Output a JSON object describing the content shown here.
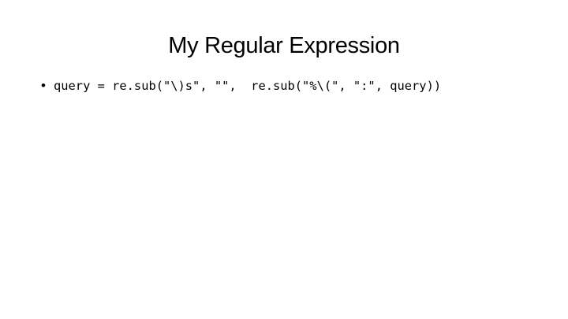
{
  "slide": {
    "title": "My Regular Expression",
    "bullets": [
      {
        "marker": "•",
        "text": "query = re.sub(\"\\)s\", \"\",  re.sub(\"%\\(\", \":\", query))"
      }
    ]
  }
}
